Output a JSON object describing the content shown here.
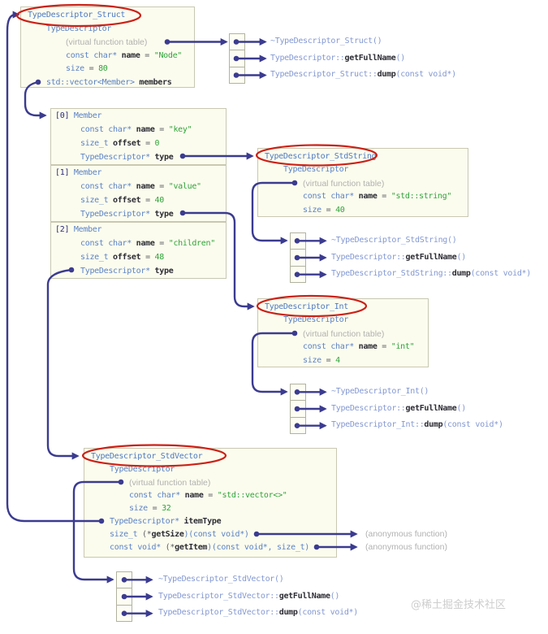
{
  "colors": {
    "connector": "#3b3b90",
    "box_background": "#fcfcee",
    "box_border": "#c8c8b2",
    "title_blue": "#4b79c5",
    "keyword_blue": "#5a82c6",
    "light_blue": "#8398d2",
    "name_dark": "#2c2c34",
    "value_green": "#2fa43a",
    "comment_gray": "#b1b1b1",
    "highlight_red": "#cb2116"
  },
  "boxes": {
    "struct": {
      "rows": [
        {
          "ind": 0,
          "tk": [
            [
              "t",
              "TypeDescriptor_Struct"
            ]
          ]
        },
        {
          "ind": 1,
          "tk": [
            [
              "k",
              "TypeDescriptor"
            ]
          ]
        },
        {
          "ind": 2,
          "tk": [
            [
              "g",
              "(virtual function table)"
            ]
          ]
        },
        {
          "ind": 2,
          "tk": [
            [
              "k",
              "const char*"
            ],
            [
              "n",
              " name"
            ],
            [
              "o",
              " = "
            ],
            [
              "v",
              "\"Node\""
            ]
          ]
        },
        {
          "ind": 2,
          "tk": [
            [
              "k",
              "size"
            ],
            [
              "o",
              " = "
            ],
            [
              "v",
              "80"
            ]
          ]
        },
        {
          "ind": 1,
          "tk": [
            [
              "k",
              "std::vector<Member>"
            ],
            [
              "n",
              " members"
            ]
          ]
        }
      ]
    },
    "member0": {
      "rows": [
        {
          "ind": 3,
          "tk": [
            [
              "i",
              "[0]"
            ],
            [
              "k",
              " Member"
            ]
          ]
        },
        {
          "ind": 4,
          "tk": [
            [
              "k",
              "const char*"
            ],
            [
              "n",
              " name"
            ],
            [
              "o",
              " = "
            ],
            [
              "v",
              "\"key\""
            ]
          ]
        },
        {
          "ind": 4,
          "tk": [
            [
              "k",
              "size_t"
            ],
            [
              "n",
              " offset"
            ],
            [
              "o",
              " = "
            ],
            [
              "v",
              "0"
            ]
          ]
        },
        {
          "ind": 4,
          "tk": [
            [
              "k",
              "TypeDescriptor*"
            ],
            [
              "n",
              " type"
            ]
          ]
        }
      ]
    },
    "member1": {
      "rows": [
        {
          "ind": 3,
          "tk": [
            [
              "i",
              "[1]"
            ],
            [
              "k",
              " Member"
            ]
          ]
        },
        {
          "ind": 4,
          "tk": [
            [
              "k",
              "const char*"
            ],
            [
              "n",
              " name"
            ],
            [
              "o",
              " = "
            ],
            [
              "v",
              "\"value\""
            ]
          ]
        },
        {
          "ind": 4,
          "tk": [
            [
              "k",
              "size_t"
            ],
            [
              "n",
              " offset"
            ],
            [
              "o",
              " = "
            ],
            [
              "v",
              "40"
            ]
          ]
        },
        {
          "ind": 4,
          "tk": [
            [
              "k",
              "TypeDescriptor*"
            ],
            [
              "n",
              " type"
            ]
          ]
        }
      ]
    },
    "member2": {
      "rows": [
        {
          "ind": 3,
          "tk": [
            [
              "i",
              "[2]"
            ],
            [
              "k",
              " Member"
            ]
          ]
        },
        {
          "ind": 4,
          "tk": [
            [
              "k",
              "const char*"
            ],
            [
              "n",
              " name"
            ],
            [
              "o",
              " = "
            ],
            [
              "v",
              "\"children\""
            ]
          ]
        },
        {
          "ind": 4,
          "tk": [
            [
              "k",
              "size_t"
            ],
            [
              "n",
              " offset"
            ],
            [
              "o",
              " = "
            ],
            [
              "v",
              "48"
            ]
          ]
        },
        {
          "ind": 4,
          "tk": [
            [
              "k",
              "TypeDescriptor*"
            ],
            [
              "n",
              " type"
            ]
          ]
        }
      ]
    },
    "stdstring": {
      "rows": [
        {
          "ind": 0,
          "tk": [
            [
              "t",
              "TypeDescriptor_StdString"
            ]
          ]
        },
        {
          "ind": 1,
          "tk": [
            [
              "k",
              "TypeDescriptor"
            ]
          ]
        },
        {
          "ind": 2,
          "tk": [
            [
              "g",
              "(virtual function table)"
            ]
          ]
        },
        {
          "ind": 2,
          "tk": [
            [
              "k",
              "const char*"
            ],
            [
              "n",
              " name"
            ],
            [
              "o",
              " = "
            ],
            [
              "v",
              "\"std::string\""
            ]
          ]
        },
        {
          "ind": 2,
          "tk": [
            [
              "k",
              "size"
            ],
            [
              "o",
              " = "
            ],
            [
              "v",
              "40"
            ]
          ]
        }
      ]
    },
    "int": {
      "rows": [
        {
          "ind": 0,
          "tk": [
            [
              "t",
              "TypeDescriptor_Int"
            ]
          ]
        },
        {
          "ind": 1,
          "tk": [
            [
              "k",
              "TypeDescriptor"
            ]
          ]
        },
        {
          "ind": 2,
          "tk": [
            [
              "g",
              "(virtual function table)"
            ]
          ]
        },
        {
          "ind": 2,
          "tk": [
            [
              "k",
              "const char*"
            ],
            [
              "n",
              " name"
            ],
            [
              "o",
              " = "
            ],
            [
              "v",
              "\"int\""
            ]
          ]
        },
        {
          "ind": 2,
          "tk": [
            [
              "k",
              "size"
            ],
            [
              "o",
              " = "
            ],
            [
              "v",
              "4"
            ]
          ]
        }
      ]
    },
    "stdvector": {
      "rows": [
        {
          "ind": 0,
          "tk": [
            [
              "t",
              "TypeDescriptor_StdVector"
            ]
          ]
        },
        {
          "ind": 1,
          "tk": [
            [
              "k",
              "TypeDescriptor"
            ]
          ]
        },
        {
          "ind": 2,
          "tk": [
            [
              "g",
              "(virtual function table)"
            ]
          ]
        },
        {
          "ind": 2,
          "tk": [
            [
              "k",
              "const char*"
            ],
            [
              "n",
              " name"
            ],
            [
              "o",
              " = "
            ],
            [
              "v",
              "\"std::vector<>\""
            ]
          ]
        },
        {
          "ind": 2,
          "tk": [
            [
              "k",
              "size"
            ],
            [
              "o",
              " = "
            ],
            [
              "v",
              "32"
            ]
          ]
        },
        {
          "ind": 1,
          "tk": [
            [
              "k",
              "TypeDescriptor*"
            ],
            [
              "n",
              " itemType"
            ]
          ]
        },
        {
          "ind": 1,
          "tk": [
            [
              "k",
              "size_t"
            ],
            [
              "o",
              " (*"
            ],
            [
              "n",
              "getSize"
            ],
            [
              "k",
              ")(const void*)"
            ]
          ]
        },
        {
          "ind": 1,
          "tk": [
            [
              "k",
              "const void*"
            ],
            [
              "o",
              " (*"
            ],
            [
              "n",
              "getItem"
            ],
            [
              "k",
              ")(const void*, size_t)"
            ]
          ]
        }
      ]
    }
  },
  "vtables": {
    "struct": {
      "rows": [
        {
          "tk": [
            [
              "l",
              "~TypeDescriptor_Struct()"
            ]
          ]
        },
        {
          "tk": [
            [
              "l",
              "TypeDescriptor::"
            ],
            [
              "n",
              "getFullName"
            ],
            [
              "l",
              "()"
            ]
          ]
        },
        {
          "tk": [
            [
              "l",
              "TypeDescriptor_Struct::"
            ],
            [
              "n",
              "dump"
            ],
            [
              "l",
              "(const void*)"
            ]
          ]
        }
      ]
    },
    "stdstring": {
      "rows": [
        {
          "tk": [
            [
              "l",
              "~TypeDescriptor_StdString()"
            ]
          ]
        },
        {
          "tk": [
            [
              "l",
              "TypeDescriptor::"
            ],
            [
              "n",
              "getFullName"
            ],
            [
              "l",
              "()"
            ]
          ]
        },
        {
          "tk": [
            [
              "l",
              "TypeDescriptor_StdString::"
            ],
            [
              "n",
              "dump"
            ],
            [
              "l",
              "(const void*)"
            ]
          ]
        }
      ]
    },
    "int": {
      "rows": [
        {
          "tk": [
            [
              "l",
              "~TypeDescriptor_Int()"
            ]
          ]
        },
        {
          "tk": [
            [
              "l",
              "TypeDescriptor::"
            ],
            [
              "n",
              "getFullName"
            ],
            [
              "l",
              "()"
            ]
          ]
        },
        {
          "tk": [
            [
              "l",
              "TypeDescriptor_Int::"
            ],
            [
              "n",
              "dump"
            ],
            [
              "l",
              "(const void*)"
            ]
          ]
        }
      ]
    },
    "stdvector": {
      "rows": [
        {
          "tk": [
            [
              "l",
              "~TypeDescriptor_StdVector()"
            ]
          ]
        },
        {
          "tk": [
            [
              "l",
              "TypeDescriptor_StdVector::"
            ],
            [
              "n",
              "getFullName"
            ],
            [
              "l",
              "()"
            ]
          ]
        },
        {
          "tk": [
            [
              "l",
              "TypeDescriptor_StdVector::"
            ],
            [
              "n",
              "dump"
            ],
            [
              "l",
              "(const void*)"
            ]
          ]
        }
      ]
    }
  },
  "annotations": {
    "anonymous": [
      "(anonymous function)",
      "(anonymous function)"
    ]
  },
  "watermark": "@稀土掘金技术社区"
}
